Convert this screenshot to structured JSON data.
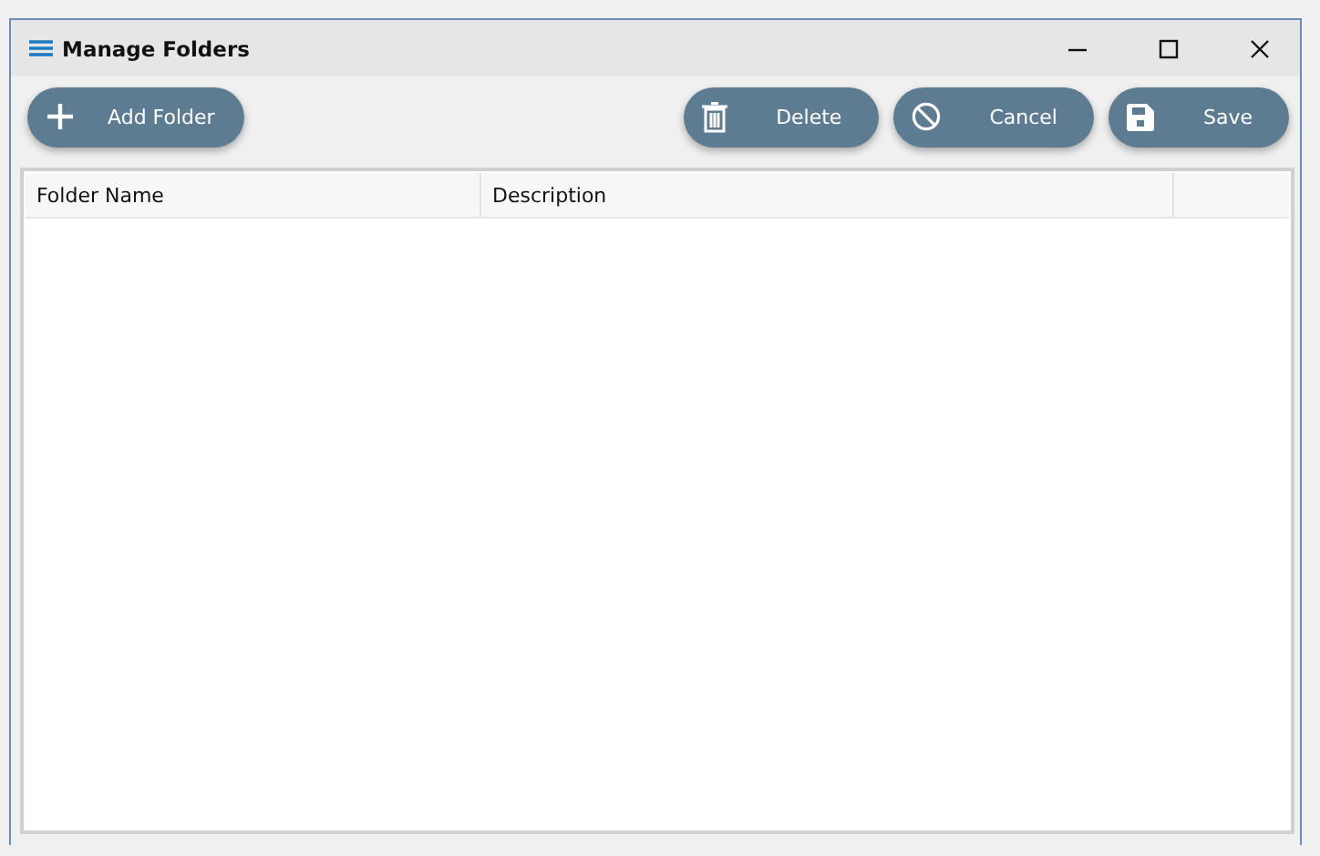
{
  "window": {
    "title": "Manage Folders"
  },
  "toolbar": {
    "left": [
      {
        "kind": "add",
        "label": "Add Folder"
      }
    ],
    "right": [
      {
        "kind": "delete",
        "label": "Delete"
      },
      {
        "kind": "cancel",
        "label": "Cancel"
      },
      {
        "kind": "save",
        "label": "Save"
      }
    ]
  },
  "table": {
    "columns": [
      "Folder Name",
      "Description"
    ]
  }
}
